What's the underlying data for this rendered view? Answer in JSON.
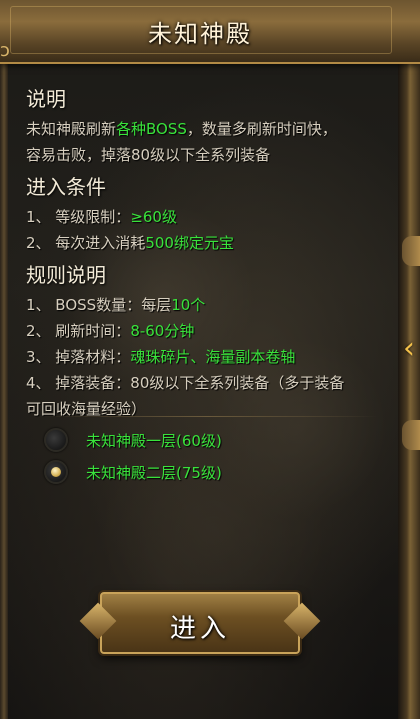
{
  "title": "未知神殿",
  "sections": {
    "desc": {
      "heading": "说明",
      "line1_a": "未知神殿刷新",
      "line1_b": "各种BOSS",
      "line1_c": "，数量多刷新时间快，",
      "line2": "容易击败，掉落80级以下全系列装备"
    },
    "conditions": {
      "heading": "进入条件",
      "item1_prefix": "1、 等级限制：",
      "item1_value": "≥60级",
      "item2_prefix": "2、 每次进入消耗",
      "item2_value": "500绑定元宝"
    },
    "rules": {
      "heading": "规则说明",
      "r1_prefix": "1、 BOSS数量：每层",
      "r1_value": "10个",
      "r2_prefix": "2、 刷新时间：",
      "r2_value": "8-60分钟",
      "r3_prefix": "3、 掉落材料：",
      "r3_value": "魂珠碎片、海量副本卷轴",
      "r4_line1": "4、 掉落装备：80级以下全系列装备（多于装备",
      "r4_line2": "可回收海量经验）"
    }
  },
  "options": [
    {
      "label": "未知神殿一层(60级)",
      "selected": false
    },
    {
      "label": "未知神殿二层(75级)",
      "selected": true
    }
  ],
  "enter_label": "进入",
  "colors": {
    "highlight": "#39e23b",
    "gold": "#c9a35a"
  }
}
